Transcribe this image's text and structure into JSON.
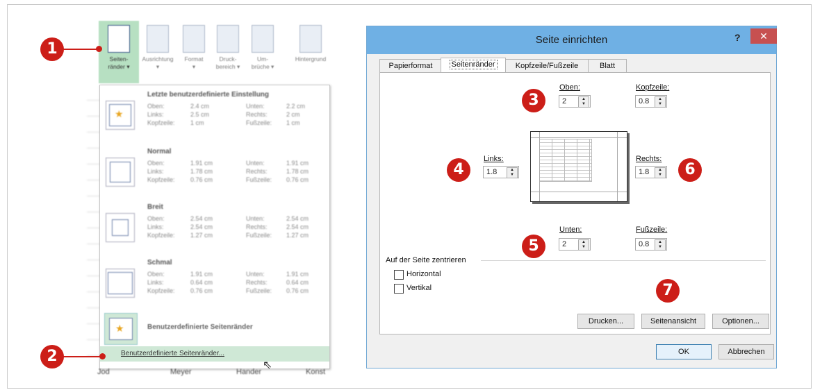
{
  "ribbon": {
    "buttons": [
      {
        "label1": "Seiten-",
        "label2": "ränder ▾"
      },
      {
        "label1": "Ausrichtung",
        "label2": "▾"
      },
      {
        "label1": "Format",
        "label2": "▾"
      },
      {
        "label1": "Druck-",
        "label2": "bereich ▾"
      },
      {
        "label1": "Um-",
        "label2": "brüche ▾"
      },
      {
        "label1": "Hintergrund",
        "label2": ""
      }
    ]
  },
  "margin_presets": [
    {
      "name": "Letzte benutzerdefinierte Einstellung",
      "rows": [
        [
          "Oben:",
          "2.4 cm",
          "Unten:",
          "2.2 cm"
        ],
        [
          "Links:",
          "2.5 cm",
          "Rechts:",
          "2 cm"
        ],
        [
          "Kopfzeile:",
          "1 cm",
          "Fußzeile:",
          "1 cm"
        ]
      ]
    },
    {
      "name": "Normal",
      "rows": [
        [
          "Oben:",
          "1.91 cm",
          "Unten:",
          "1.91 cm"
        ],
        [
          "Links:",
          "1.78 cm",
          "Rechts:",
          "1.78 cm"
        ],
        [
          "Kopfzeile:",
          "0.76 cm",
          "Fußzeile:",
          "0.76 cm"
        ]
      ]
    },
    {
      "name": "Breit",
      "rows": [
        [
          "Oben:",
          "2.54 cm",
          "Unten:",
          "2.54 cm"
        ],
        [
          "Links:",
          "2.54 cm",
          "Rechts:",
          "2.54 cm"
        ],
        [
          "Kopfzeile:",
          "1.27 cm",
          "Fußzeile:",
          "1.27 cm"
        ]
      ]
    },
    {
      "name": "Schmal",
      "rows": [
        [
          "Oben:",
          "1.91 cm",
          "Unten:",
          "1.91 cm"
        ],
        [
          "Links:",
          "0.64 cm",
          "Rechts:",
          "0.64 cm"
        ],
        [
          "Kopfzeile:",
          "0.76 cm",
          "Fußzeile:",
          "0.76 cm"
        ]
      ]
    }
  ],
  "custom_margins_label": "Benutzerdefinierte Seitenränder",
  "custom_margins_menu_item": "Benutzerdefinierte Seitenränder...",
  "sheet_bottom": [
    "Jod",
    "Meyer",
    "Hander",
    "Konst"
  ],
  "callouts": [
    "1",
    "2",
    "3",
    "4",
    "5",
    "6",
    "7"
  ],
  "dialog": {
    "title": "Seite einrichten",
    "help": "?",
    "close": "✕",
    "tabs": [
      "Papierformat",
      "Seitenränder",
      "Kopfzeile/Fußzeile",
      "Blatt"
    ],
    "fields": {
      "oben": {
        "label": "Oben:",
        "value": "2"
      },
      "kopfzeile": {
        "label": "Kopfzeile:",
        "value": "0.8"
      },
      "links": {
        "label": "Links:",
        "value": "1.8"
      },
      "rechts": {
        "label": "Rechts:",
        "value": "1.8"
      },
      "unten": {
        "label": "Unten:",
        "value": "2"
      },
      "fusszeile": {
        "label": "Fußzeile:",
        "value": "0.8"
      }
    },
    "center_group": "Auf der Seite zentrieren",
    "horizontal": "Horizontal",
    "vertikal": "Vertikal",
    "buttons": {
      "drucken": "Drucken...",
      "seitenansicht": "Seitenansicht",
      "optionen": "Optionen...",
      "ok": "OK",
      "abbrechen": "Abbrechen"
    }
  },
  "colors": {
    "callout": "#cc1e18",
    "titlebar": "#6fb0e4",
    "highlight": "#b7e0c2"
  }
}
